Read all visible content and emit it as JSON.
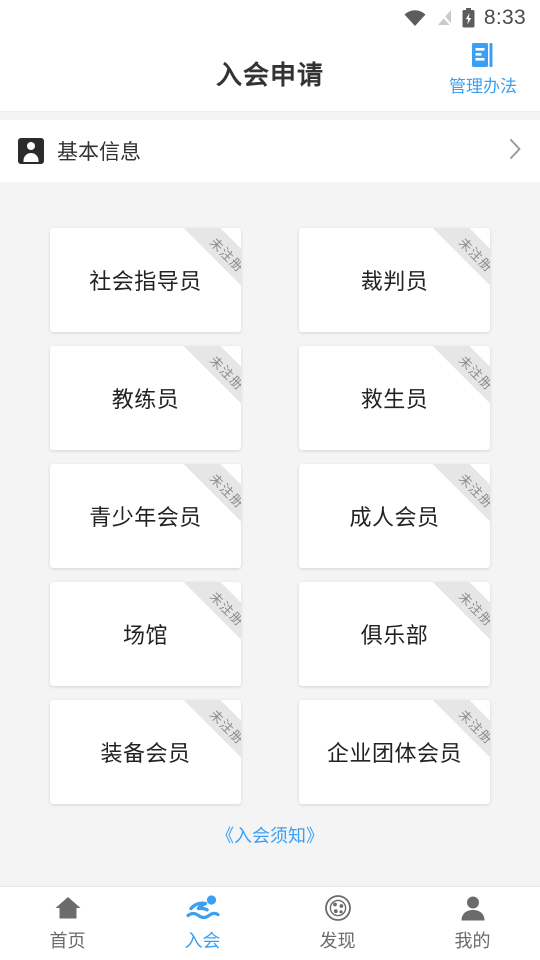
{
  "status_bar": {
    "time": "8:33",
    "icons": [
      "wifi-icon",
      "signal-off-icon",
      "battery-charging-icon"
    ]
  },
  "header": {
    "title": "入会申请",
    "action_label": "管理办法",
    "action_icon": "document-icon",
    "accent_color": "#3aa0f3"
  },
  "basic_info": {
    "label": "基本信息",
    "icon": "person-badge-icon",
    "chevron": "chevron-right-icon"
  },
  "cards": [
    {
      "label": "社会指导员",
      "badge": "未注册"
    },
    {
      "label": "裁判员",
      "badge": "未注册"
    },
    {
      "label": "教练员",
      "badge": "未注册"
    },
    {
      "label": "救生员",
      "badge": "未注册"
    },
    {
      "label": "青少年会员",
      "badge": "未注册"
    },
    {
      "label": "成人会员",
      "badge": "未注册"
    },
    {
      "label": "场馆",
      "badge": "未注册"
    },
    {
      "label": "俱乐部",
      "badge": "未注册"
    },
    {
      "label": "装备会员",
      "badge": "未注册"
    },
    {
      "label": "企业团体会员",
      "badge": "未注册"
    }
  ],
  "notice": {
    "link_text": "《入会须知》"
  },
  "tabbar": {
    "items": [
      {
        "label": "首页",
        "icon": "home-icon",
        "active": false
      },
      {
        "label": "入会",
        "icon": "swimmer-icon",
        "active": true
      },
      {
        "label": "发现",
        "icon": "discover-ball-icon",
        "active": false
      },
      {
        "label": "我的",
        "icon": "person-icon",
        "active": false
      }
    ],
    "active_color": "#3aa0f3",
    "inactive_color": "#6b6b6b"
  }
}
